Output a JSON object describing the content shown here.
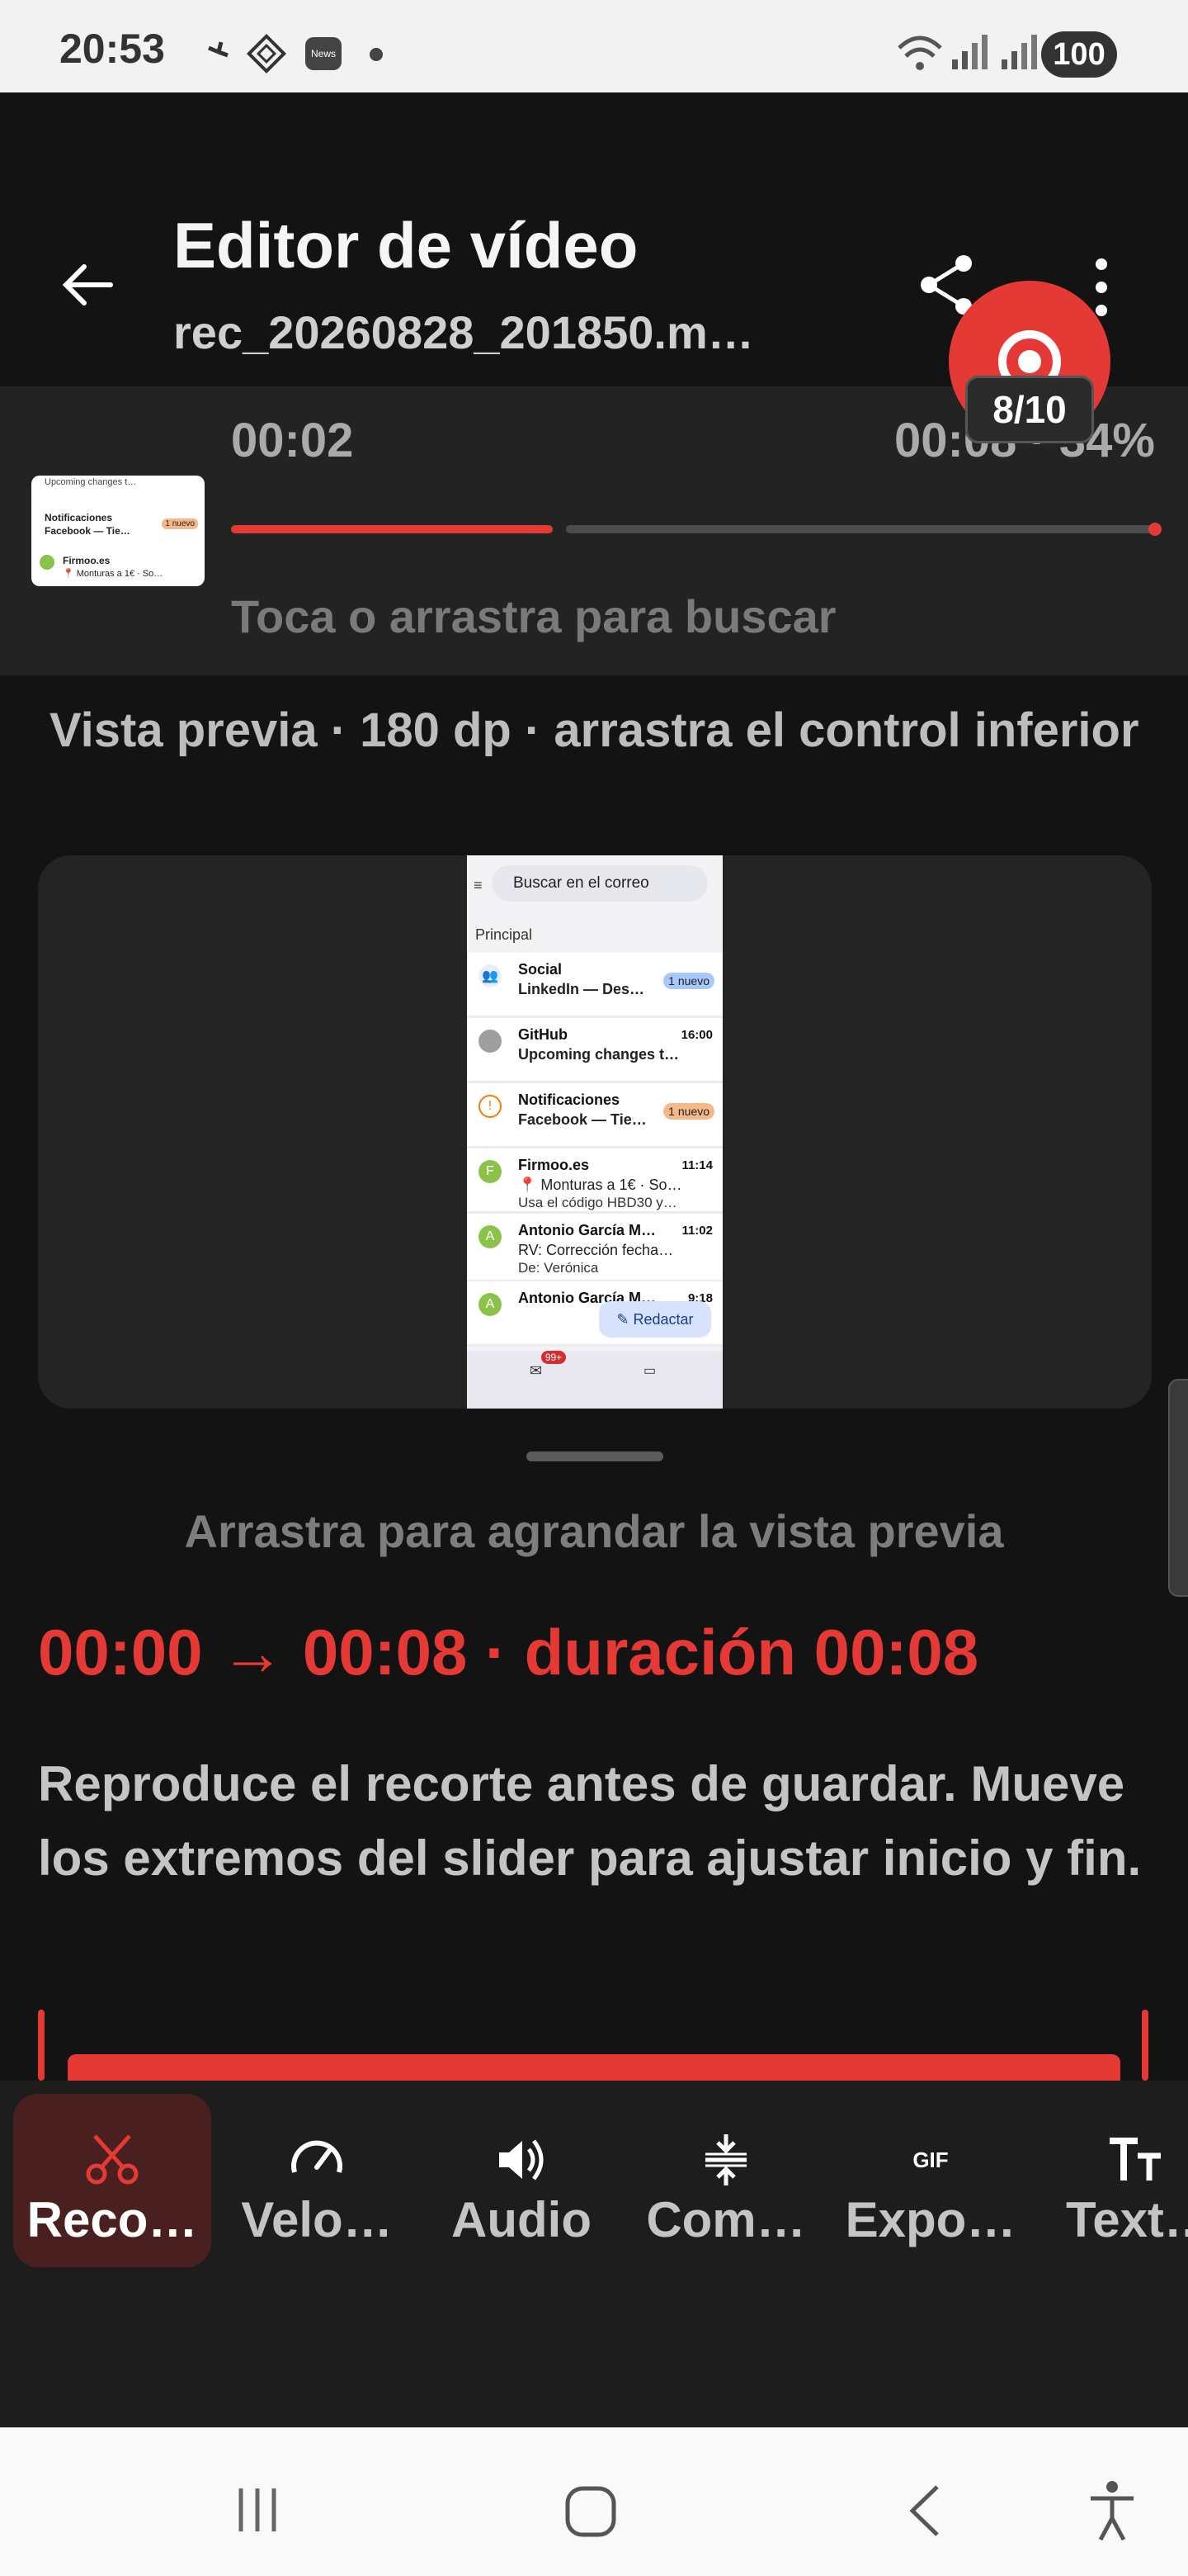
{
  "status_bar": {
    "time": "20:53",
    "battery": "100",
    "notification_icons": [
      "fan-icon",
      "tarot-icon",
      "news-icon",
      "dot-icon"
    ],
    "system_icons": [
      "wifi-icon",
      "signal-icon",
      "signal-icon"
    ]
  },
  "header": {
    "title": "Editor de vídeo",
    "filename": "rec_20260828_201850.m…",
    "icons": [
      "back-arrow-icon",
      "share-icon",
      "more-vert-icon"
    ]
  },
  "record_fab": {
    "counter": "8/10"
  },
  "seek": {
    "current": "00:02",
    "end_and_percent": "00:08 · 34%",
    "progress": 0.34,
    "hint": "Toca o arrastra para buscar"
  },
  "preview": {
    "caption": "Vista previa · 180 dp · arrastra el control inferior",
    "drag_hint": "Arrastra para agrandar la vista previa",
    "phone": {
      "search": "Buscar en el correo",
      "section": "Principal",
      "compose": "Redactar",
      "badge": "99+",
      "mails": [
        {
          "from": "Social",
          "line2": "LinkedIn — Des…",
          "badge": "1 nuevo",
          "avatar": "",
          "time": ""
        },
        {
          "from": "GitHub",
          "line2": "Upcoming changes t…",
          "time": "16:00",
          "avatar": ""
        },
        {
          "from": "Notificaciones",
          "line2": "Facebook — Tie…",
          "badge": "1 nuevo",
          "avatar": ""
        },
        {
          "from": "Firmoo.es",
          "line2": "📍 Monturas a 1€ · So…",
          "line3": "Usa el código HBD30 y…",
          "time": "11:14",
          "avatar": "F"
        },
        {
          "from": "Antonio García M…",
          "line2": "RV: Corrección fecha…",
          "line3": "De: Verónica",
          "time": "11:02",
          "avatar": "A"
        },
        {
          "from": "Antonio García M…",
          "time": "9:18",
          "avatar": "A"
        }
      ]
    }
  },
  "trim": {
    "range": "00:00 → 00:08 · duración 00:08",
    "info": "Reproduce el recorte antes de guardar. Mueve los extremos del slider para ajustar inicio y fin."
  },
  "toolbar": {
    "items": [
      {
        "label": "Reco…",
        "icon": "scissors-icon",
        "active": true
      },
      {
        "label": "Velo…",
        "icon": "speed-icon",
        "active": false
      },
      {
        "label": "Audio",
        "icon": "volume-icon",
        "active": false
      },
      {
        "label": "Com…",
        "icon": "compress-icon",
        "active": false
      },
      {
        "label": "Expo…",
        "icon": "gif-icon",
        "active": false
      },
      {
        "label": "Text…",
        "icon": "text-size-icon",
        "active": false
      }
    ]
  },
  "colors": {
    "accent": "#e53935",
    "background": "#131313",
    "panel": "#232323"
  }
}
